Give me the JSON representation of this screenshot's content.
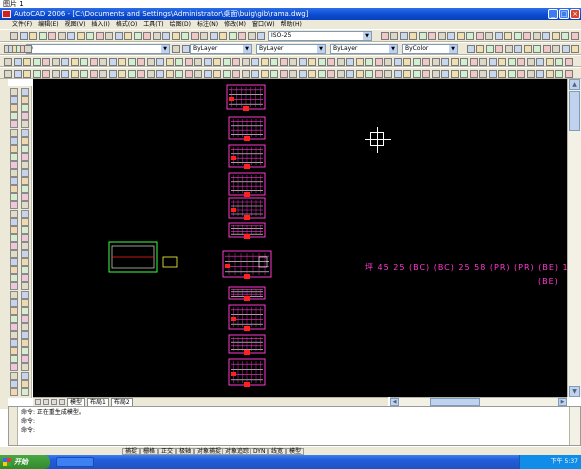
{
  "caption": "图片 1",
  "window": {
    "title": "AutoCAD 2006 - [C:\\Documents and Settings\\Administrator\\桌面\\buig\\gib\\rama.dwg]"
  },
  "menu": [
    "文件(F)",
    "编辑(E)",
    "视图(V)",
    "插入(I)",
    "格式(O)",
    "工具(T)",
    "绘图(D)",
    "标注(N)",
    "修改(M)",
    "窗口(W)",
    "帮助(H)"
  ],
  "toolbar": {
    "layer_select": "0",
    "style_select": "ByLayer",
    "linetype_select": "ByLayer",
    "lineweight_select": "ByLayer",
    "text_style_select": "ISO-25",
    "plot_style_select": "ByColor"
  },
  "drawing": {
    "pink_note_line1": "坪  45  25  (BC) (BC)  25  58  (PR) (PR) (BE)  1",
    "pink_note_line2": "(BE)"
  },
  "layout_tabs": [
    "模型",
    "布局1",
    "布局2"
  ],
  "command_lines": [
    "命令: 正在重生成模型。",
    "命令:",
    "命令:"
  ],
  "status": {
    "coords": "",
    "modes": [
      "捕捉",
      "栅格",
      "正交",
      "极轴",
      "对象捕捉",
      "对象追踪",
      "DYN",
      "线宽",
      "模型"
    ]
  },
  "taskbar": {
    "start_label": "开始",
    "clock": "下午 5:37"
  },
  "colors": {
    "canvas": "#000000",
    "drawing_pink": "#ff3ad0",
    "drawing_red": "#ff2020",
    "drawing_white": "#ffffff",
    "drawing_green": "#40ff40",
    "drawing_yellow": "#ffff40",
    "titlebar": "#0a4ad0",
    "chrome": "#ece9d8"
  }
}
